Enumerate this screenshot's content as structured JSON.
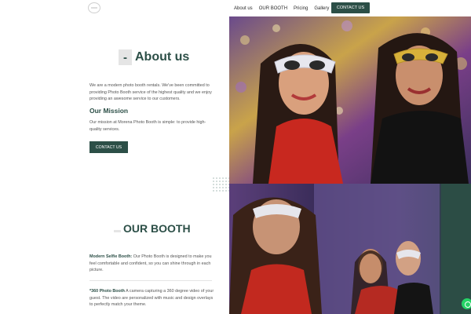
{
  "nav": {
    "links": [
      "About us",
      "OUR BOOTH",
      "Pricing",
      "Gallery"
    ],
    "cta": "CONTACT US"
  },
  "about": {
    "dash": "-",
    "title": "About us",
    "intro": "We are a modern photo booth rentals. We've been committed to providing Photo Booth service of the highest quality and we enjoy providing an awesome service to our customers.",
    "mission_title": "Our Mission",
    "mission_text": "Our mission at Morena Photo Booth is simple: to provide high-quality services.",
    "cta": "CONTACT US"
  },
  "booth": {
    "dash": "—",
    "title": "OUR BOOTH",
    "item1_title": "Modern Selfie Booth:",
    "item1_text": " Our Photo Booth is designed to make you feel comfortable and confident, so you can shine through in each picture.",
    "item2_title": "*360 Photo Booth",
    "item2_text": " A camera capturing a 360 degree video of your guest. The video are personalized with music and design overlays to perfectly match your theme."
  },
  "colors": {
    "accent": "#2c4f47",
    "whatsapp": "#25d366"
  },
  "icons": [
    "logo-icon",
    "whatsapp-icon"
  ]
}
